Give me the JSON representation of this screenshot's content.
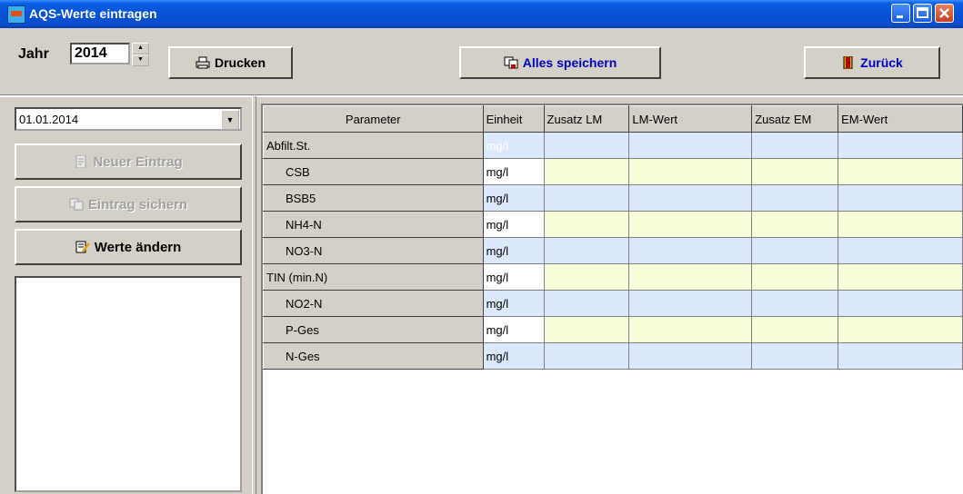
{
  "window": {
    "title": "AQS-Werte eintragen"
  },
  "toolbar": {
    "jahr_label": "Jahr",
    "jahr_value": "2014",
    "drucken_label": "Drucken",
    "speichern_label": "Alles speichern",
    "zurueck_label": "Zurück"
  },
  "left": {
    "date_value": "01.01.2014",
    "neu_label": "Neuer Eintrag",
    "sichern_label": "Eintrag sichern",
    "aendern_label": "Werte ändern"
  },
  "grid": {
    "headers": [
      "Parameter",
      "Einheit",
      "Zusatz LM",
      "LM-Wert",
      "Zusatz EM",
      "EM-Wert"
    ],
    "rows": [
      {
        "parameter": "Abfilt.St.",
        "einheit": "mg/l"
      },
      {
        "parameter": "CSB",
        "einheit": "mg/l"
      },
      {
        "parameter": "BSB5",
        "einheit": "mg/l"
      },
      {
        "parameter": "NH4-N",
        "einheit": "mg/l"
      },
      {
        "parameter": "NO3-N",
        "einheit": "mg/l"
      },
      {
        "parameter": "TIN (min.N)",
        "einheit": "mg/l"
      },
      {
        "parameter": "NO2-N",
        "einheit": "mg/l"
      },
      {
        "parameter": "P-Ges",
        "einheit": "mg/l"
      },
      {
        "parameter": "N-Ges",
        "einheit": "mg/l"
      }
    ]
  },
  "colors": {
    "titlebar": "#0552d6",
    "row_blue": "#dce8fc",
    "row_yellow": "#f4fcd8",
    "link_blue": "#0000c0"
  }
}
